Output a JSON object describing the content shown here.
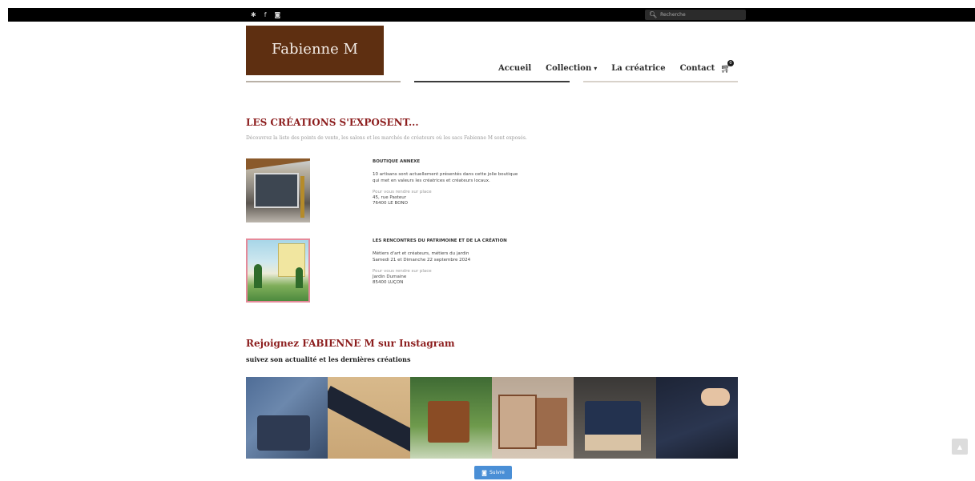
{
  "topbar": {
    "social": [
      {
        "icon": "pinterest-icon",
        "glyph": "✱"
      },
      {
        "icon": "facebook-icon",
        "glyph": "f"
      },
      {
        "icon": "instagram-icon",
        "glyph": "◙"
      }
    ],
    "search": {
      "placeholder": "Recherche",
      "icon": "search-icon"
    }
  },
  "logo": {
    "text": "Fabienne M",
    "color": "#5e2f11"
  },
  "nav": {
    "items": [
      {
        "label": "Accueil"
      },
      {
        "label": "Collection",
        "has_dropdown": true
      },
      {
        "label": "La créatrice"
      },
      {
        "label": "Contact"
      }
    ],
    "cart": {
      "icon": "cart-icon",
      "count": "0"
    }
  },
  "section": {
    "title": "LES CRÉATIONS S'EXPOSENT...",
    "intro": "Découvrez la liste des points de vente, les salons et les marchés de créateurs où les sacs Fabienne M sont exposés.",
    "events": [
      {
        "title": "BOUTIQUE ANNEXE",
        "desc1": "10 artisans sont actuellement présentés dans cette jolie boutique",
        "desc2": "qui met en valeurs les créatrices et créateurs locaux.",
        "go_label": "Pour vous rendre sur place",
        "addr1": "45, rue Pasteur",
        "addr2": "76400 LE BONO"
      },
      {
        "title": "LES RENCONTRES DU PATRIMOINE ET DE LA CRÉATION",
        "desc1": "Métiers d'art et créateurs, métiers du jardin",
        "desc2": "Samedi 21 et Dimanche 22 septembre 2024",
        "go_label": "Pour vous rendre sur place",
        "addr1": "Jardin Dumaine",
        "addr2": "85400 LUÇON"
      }
    ]
  },
  "instagram": {
    "title": "Rejoignez FABIENNE M sur Instagram",
    "subtitle": "suivez son actualité et les dernières créations",
    "follow_label": "Suivre",
    "photos": [
      "p1",
      "p2",
      "p3",
      "p4",
      "p5",
      "p6"
    ]
  },
  "colors": {
    "accent_red": "#8c1d1d",
    "brand_brown": "#5e2f11",
    "follow_blue": "#4a8fd6"
  }
}
